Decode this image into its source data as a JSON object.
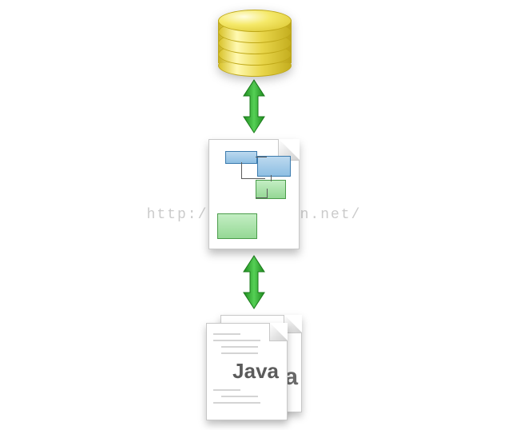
{
  "watermark": "http://blog.csdn.net/",
  "nodes": {
    "database": {
      "kind": "database-cylinder"
    },
    "mapping": {
      "kind": "diagram-document"
    },
    "java": {
      "kind": "java-source",
      "label": "Java"
    }
  },
  "arrows": [
    {
      "from": "database",
      "to": "mapping",
      "bidirectional": true
    },
    {
      "from": "mapping",
      "to": "java",
      "bidirectional": true
    }
  ],
  "colors": {
    "database": "#e8d549",
    "arrow": "#2fa82f",
    "blue_box": "#8ebfe3",
    "green_box": "#95d895"
  }
}
